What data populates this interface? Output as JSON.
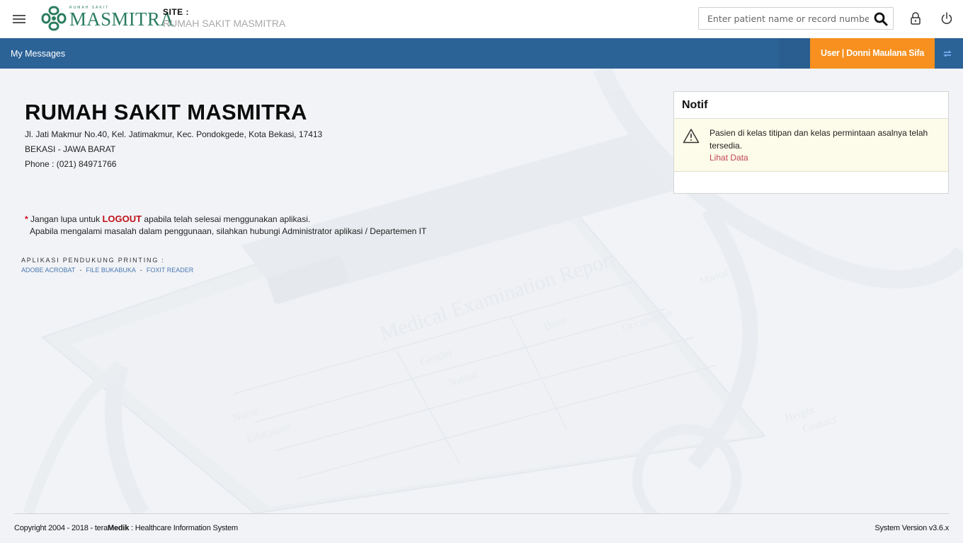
{
  "header": {
    "logo_top_text": "RUMAH SAKIT",
    "logo_word": "MASMITRA",
    "site_label": "SITE :",
    "site_name": "RUMAH SAKIT MASMITRA",
    "search_placeholder": "Enter patient name or record number",
    "icons": [
      "menu-icon",
      "search-icon",
      "lock-icon",
      "power-icon"
    ]
  },
  "navbar": {
    "messages_label": "My Messages",
    "user_label": "User | Donni Maulana Sifa",
    "refresh_icon": "refresh-icon",
    "colors": {
      "bar": "#2c6397",
      "user_badge": "#f7901e"
    }
  },
  "hospital": {
    "name": "RUMAH SAKIT MASMITRA",
    "address": "Jl. Jati Makmur No.40, Kel. Jatimakmur, Kec. Pondokgede, Kota Bekasi, 17413",
    "region": "BEKASI - JAWA BARAT",
    "phone": "Phone : (021) 84971766"
  },
  "notice": {
    "star": "*",
    "before": "Jangan lupa untuk",
    "logout_word": "LOGOUT",
    "after": "apabila telah selesai menggunakan aplikasi.",
    "line2": "Apabila mengalami masalah dalam penggunaan, silahkan hubungi Administrator aplikasi / Departemen IT"
  },
  "printing": {
    "title": "APLIKASI PENDUKUNG PRINTING :",
    "links": [
      "ADOBE ACROBAT",
      "FILE BUKABUKA",
      "FOXIT READER"
    ],
    "separator": "-"
  },
  "notif": {
    "title": "Notif",
    "message": "Pasien di kelas titipan dan kelas permintaan asalnya telah tersedia.",
    "link": "Lihat Data",
    "icon": "warning-icon"
  },
  "background": {
    "form_title": "Medical Examination Report",
    "words": [
      "Born",
      "Occupation",
      "Gender",
      "Nation",
      "Name",
      "Education",
      "Height",
      "Contact",
      "Marital"
    ]
  },
  "footer": {
    "copyright_prefix": "Copyright 2004 - 2018 - tera",
    "copyright_brand": "Medik",
    "copyright_suffix": " : Healthcare Information System",
    "version": "System Version v3.6.x"
  }
}
